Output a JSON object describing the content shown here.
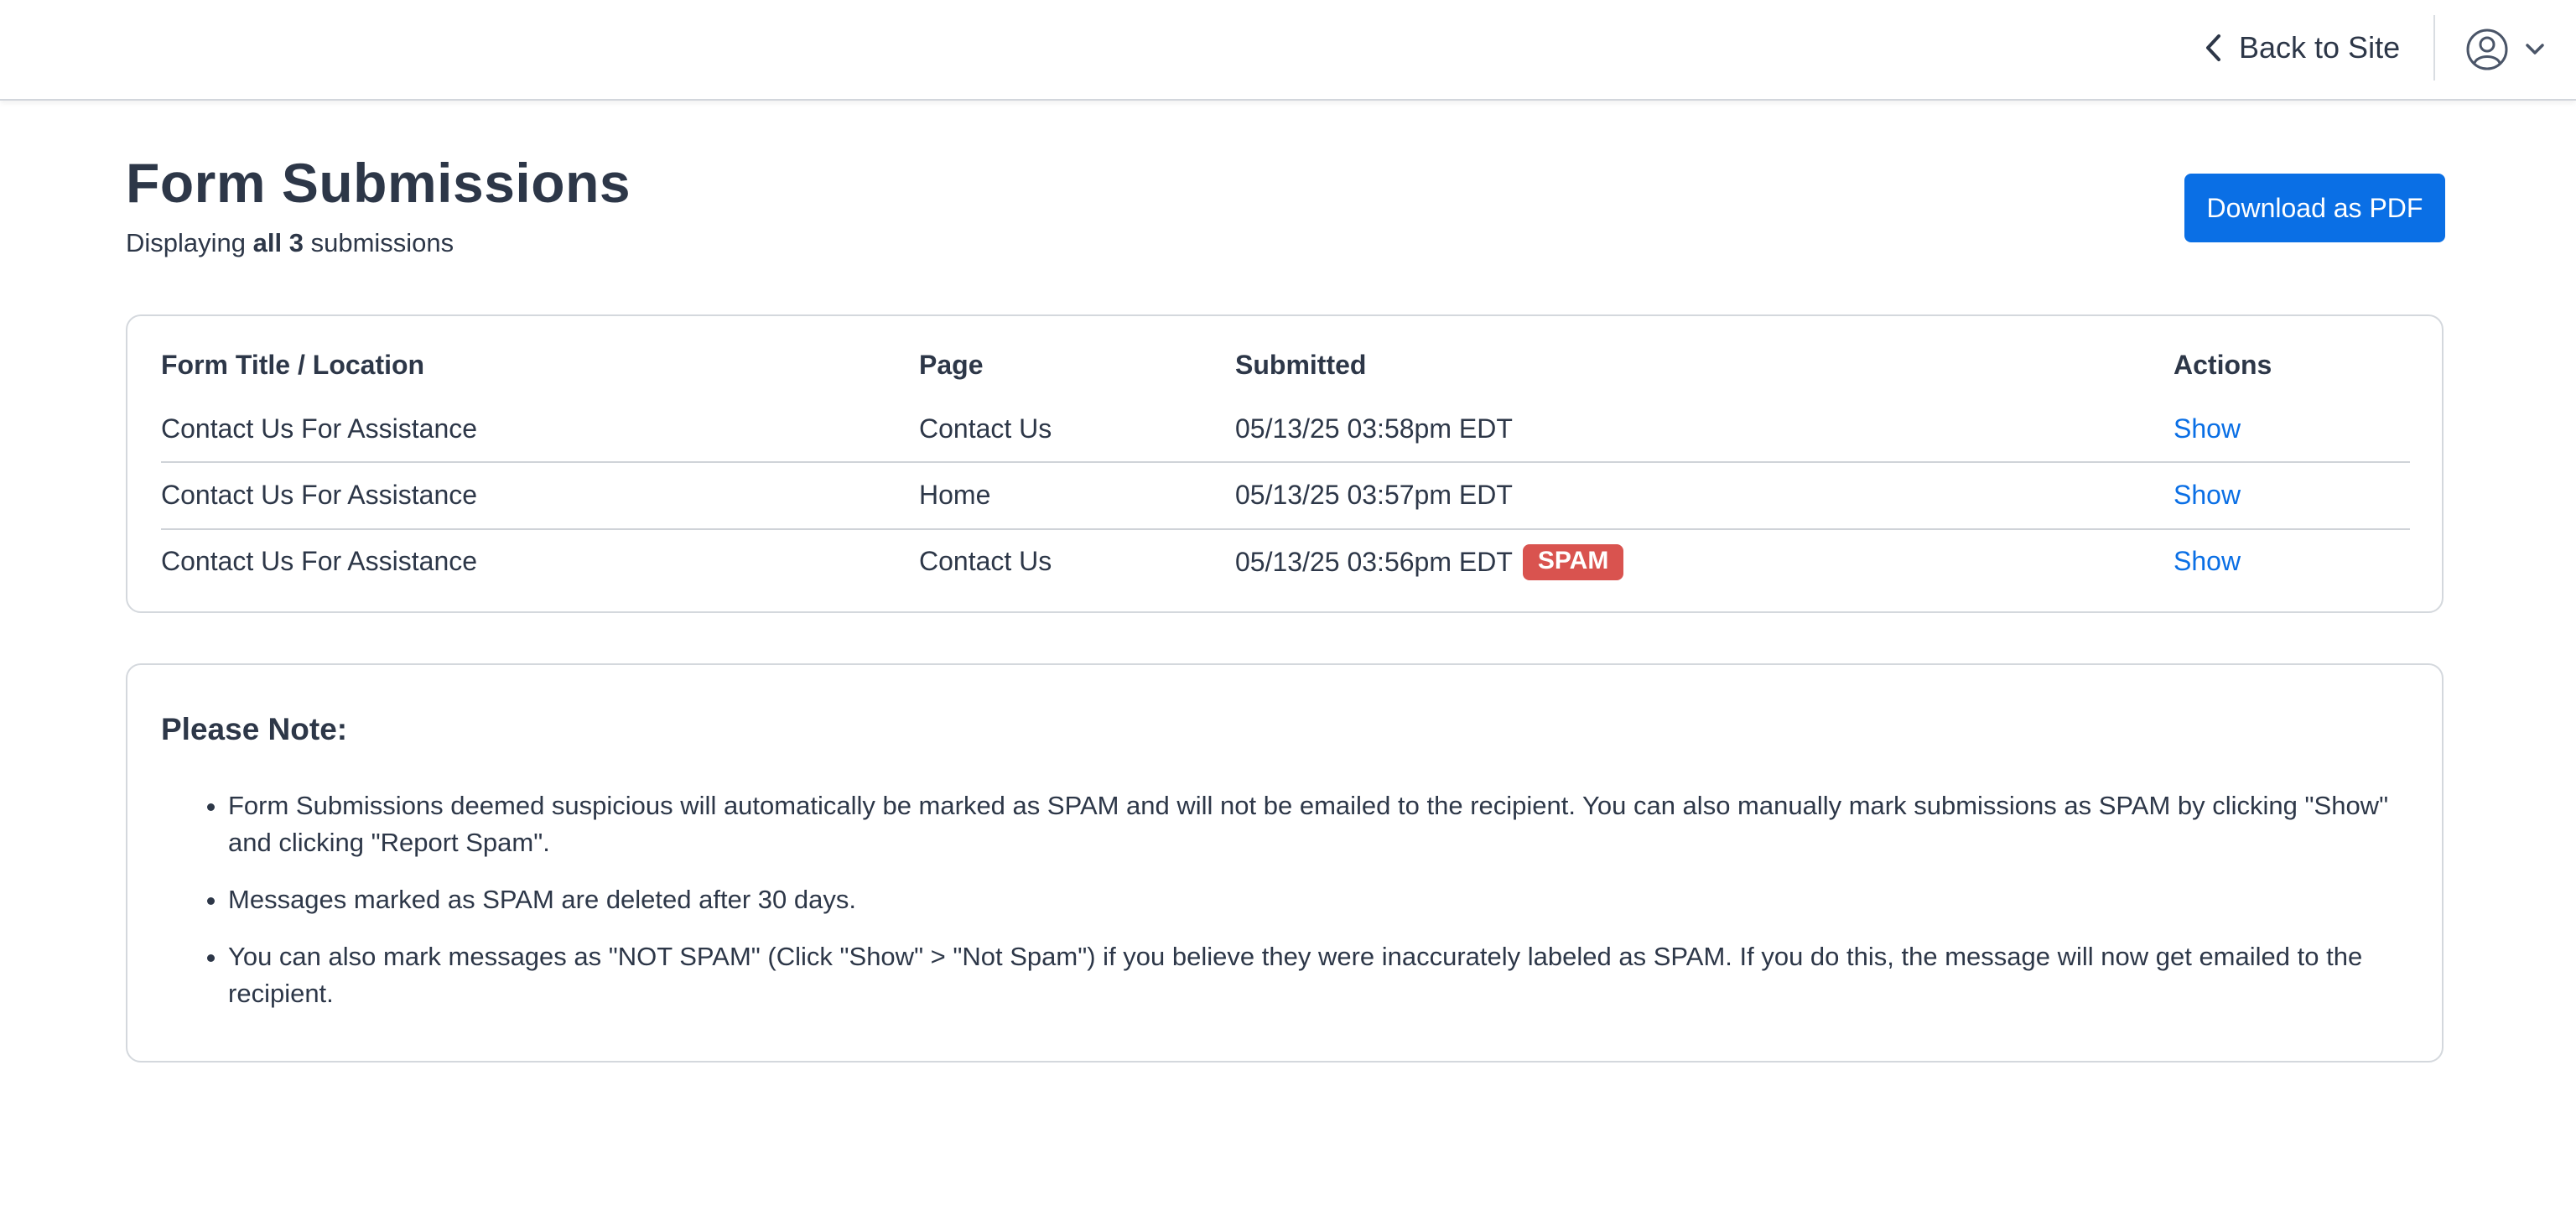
{
  "header": {
    "back_label": "Back to Site",
    "back_icon": "chevron-left-icon",
    "user_icon": "user-circle-icon",
    "user_chevron_icon": "chevron-down-icon"
  },
  "page": {
    "title": "Form Submissions",
    "subtitle_prefix": "Displaying",
    "subtitle_bold": "all 3",
    "subtitle_suffix": "submissions",
    "download_button": "Download as PDF"
  },
  "table": {
    "columns": [
      "Form Title / Location",
      "Page",
      "Submitted",
      "Actions"
    ],
    "rows": [
      {
        "form": "Contact Us For Assistance",
        "page": "Contact Us",
        "submitted": "05/13/25 03:58pm EDT",
        "badge": "",
        "action": "Show"
      },
      {
        "form": "Contact Us For Assistance",
        "page": "Home",
        "submitted": "05/13/25 03:57pm EDT",
        "badge": "",
        "action": "Show"
      },
      {
        "form": "Contact Us For Assistance",
        "page": "Contact Us",
        "submitted": "05/13/25 03:56pm EDT",
        "badge": "SPAM",
        "action": "Show"
      }
    ]
  },
  "note": {
    "heading": "Please Note:",
    "items": [
      "Form Submissions deemed suspicious will automatically be marked as SPAM and will not be emailed to the recipient. You can also manually mark submissions as SPAM by clicking \"Show\" and clicking \"Report Spam\".",
      "Messages marked as SPAM are deleted after 30 days.",
      "You can also mark messages as \"NOT SPAM\" (Click \"Show\" > \"Not Spam\") if you believe they were inaccurately labeled as SPAM. If you do this, the message will now get emailed to the recipient."
    ]
  },
  "colors": {
    "primary": "#0a6fe5",
    "spam_badge": "#d9534f",
    "text": "#2d3748"
  }
}
